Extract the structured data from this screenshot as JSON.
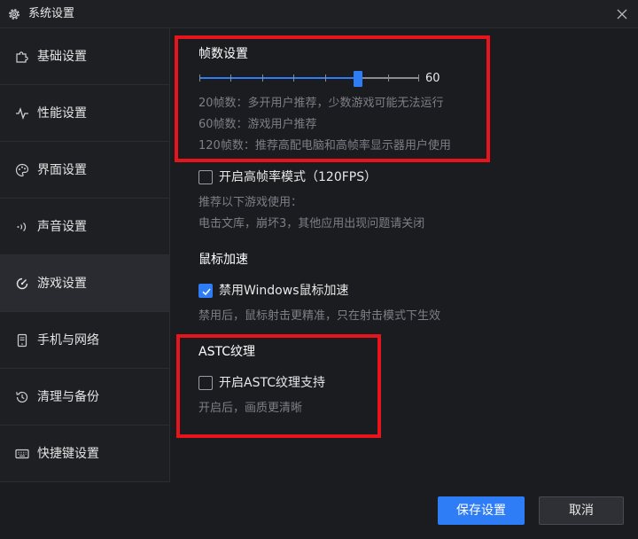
{
  "window": {
    "title": "系统设置"
  },
  "sidebar": {
    "items": [
      {
        "label": "基础设置",
        "icon": "puzzle-icon",
        "active": false
      },
      {
        "label": "性能设置",
        "icon": "pulse-icon",
        "active": false
      },
      {
        "label": "界面设置",
        "icon": "palette-icon",
        "active": false
      },
      {
        "label": "声音设置",
        "icon": "sound-wave-icon",
        "active": false
      },
      {
        "label": "游戏设置",
        "icon": "game-icon",
        "active": true
      },
      {
        "label": "手机与网络",
        "icon": "phone-network-icon",
        "active": false
      },
      {
        "label": "清理与备份",
        "icon": "backup-clock-icon",
        "active": false
      },
      {
        "label": "快捷键设置",
        "icon": "keyboard-icon",
        "active": false
      }
    ]
  },
  "fps": {
    "title": "帧数设置",
    "value": "60",
    "slider_fraction": 0.72,
    "hints": [
      "20帧数：多开用户推荐，少数游戏可能无法运行",
      "60帧数：游戏用户推荐",
      "120帧数：推荐高配电脑和高帧率显示器用户使用"
    ]
  },
  "high_fps": {
    "label": "开启高帧率模式（120FPS）",
    "checked": false,
    "hint1": "推荐以下游戏使用：",
    "hint2": " 电击文库，崩坏3，其他应用出现问题请关闭"
  },
  "mouse": {
    "title": "鼠标加速",
    "label": "禁用Windows鼠标加速",
    "checked": true,
    "hint": "禁用后，鼠标射击更精准，只在射击模式下生效"
  },
  "astc": {
    "title": "ASTC纹理",
    "label": "开启ASTC纹理支持",
    "checked": false,
    "hint": "开启后，画质更清晰"
  },
  "footer": {
    "save_label": "保存设置",
    "cancel_label": "取消"
  },
  "colors": {
    "accent": "#2e7cf6",
    "highlight_box": "#e8141c",
    "background": "#1b1c20"
  }
}
